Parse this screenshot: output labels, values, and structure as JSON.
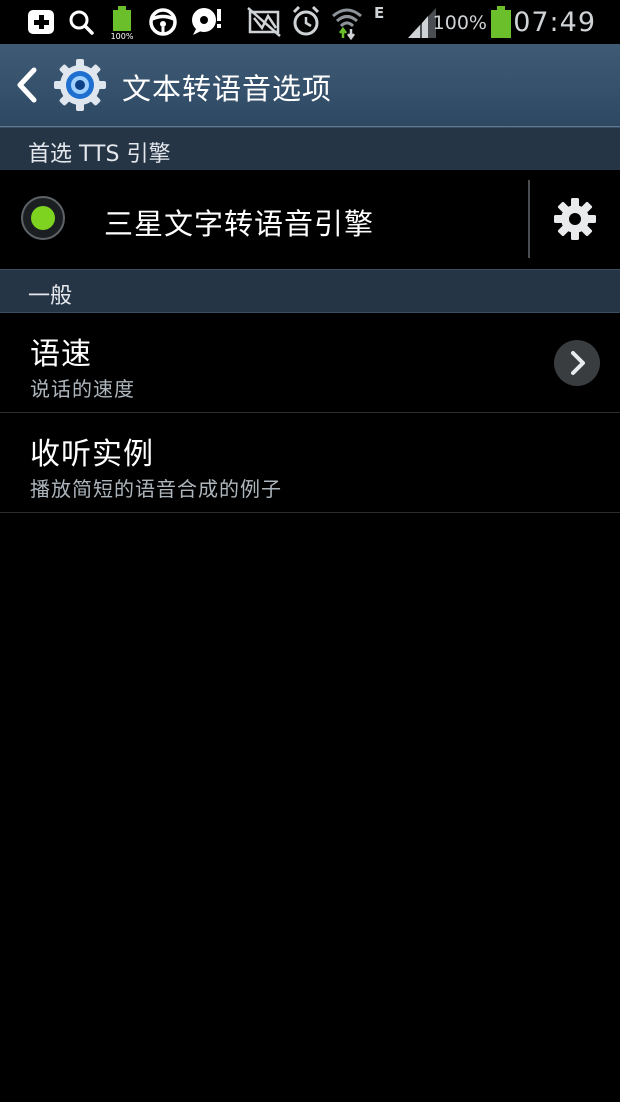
{
  "status_bar": {
    "battery_percent": "100%",
    "time": "07:49",
    "network_type": "E",
    "icons": [
      "add-box-icon",
      "search-icon",
      "battery-charging-icon",
      "steering-wheel-icon",
      "chat-bubble-icon",
      "mute-icon",
      "alarm-icon",
      "wifi-icon",
      "network-e-icon",
      "signal-icon",
      "battery-icon"
    ]
  },
  "action_bar": {
    "title": "文本转语音选项",
    "back_icon": "chevron-left-icon",
    "app_icon": "settings-gear-icon"
  },
  "sections": {
    "preferred_engine": {
      "header": "首选 TTS 引擎",
      "engine_name": "三星文字转语音引擎",
      "engine_selected": true
    },
    "general": {
      "header": "一般",
      "speech_rate_title": "语速",
      "speech_rate_subtitle": "说话的速度",
      "listen_example_title": "收听实例",
      "listen_example_subtitle": "播放简短的语音合成的例子"
    }
  },
  "colors": {
    "action_bar": "#34506b",
    "section_header": "#263546",
    "radio_selected": "#7ed321",
    "battery_green": "#6abf2a"
  }
}
